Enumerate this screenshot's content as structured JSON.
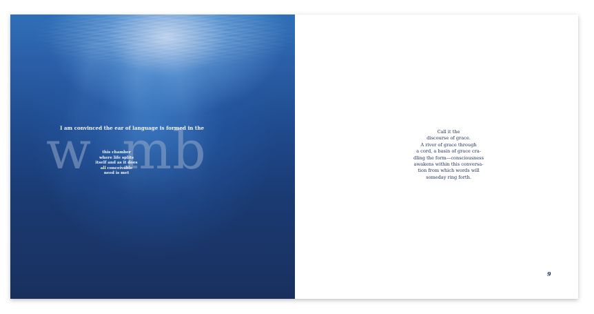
{
  "left_page": {
    "intro_line": "I am convinced the ear of language is formed in the",
    "big_word_start": "w",
    "big_word_end": "mb",
    "chamber_lines": [
      "this chamber",
      "where life splits",
      "itself and as it does",
      "all conceivable",
      "need is met"
    ]
  },
  "right_page": {
    "poem_lines": [
      "Call it the",
      "discourse of grace.",
      "A river of grace through",
      "a cord, a basin of grace cra-",
      "dling the form—consciousness",
      "awakens within this conversa-",
      "tion from which words will",
      "someday ring forth."
    ],
    "page_number": "9"
  },
  "colors": {
    "ink": "#1a2b57",
    "water_deep": "#19305e",
    "water_light": "#2f6fb8"
  }
}
